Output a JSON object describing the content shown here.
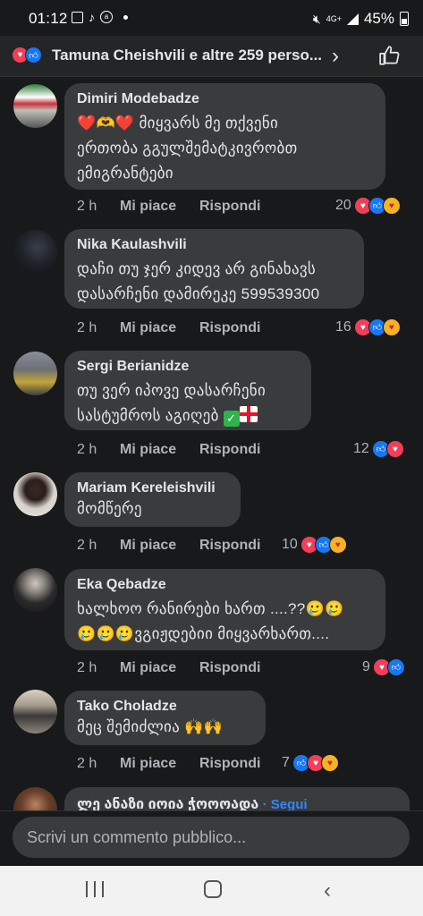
{
  "status_bar": {
    "time": "01:12",
    "network": "4G+",
    "battery": "45%"
  },
  "header": {
    "reaction_summary": "Tamuna Cheishvili e altre 259 perso..."
  },
  "comments": [
    {
      "author": "Dimiri Modebadze",
      "emoji_prefix": "❤️🫶❤️",
      "text": "მიყვარს მე თქვენი\nერთობა გგულშემატკივრობთ\nემიგრანტები",
      "time": "2 h",
      "reaction_count": "20",
      "reactions": [
        "love",
        "like",
        "care"
      ]
    },
    {
      "author": "Nika Kaulashvili",
      "text": "დაჩი თუ ჯერ კიდევ არ გინახავს\nდასარჩენი დამირეკე 599539300",
      "time": "2 h",
      "reaction_count": "16",
      "reactions": [
        "love",
        "like",
        "care"
      ]
    },
    {
      "author": "Sergi Berianidze",
      "text": "თუ ვერ იპოვე დასარჩენი\nსასტუმროს აგიღებ",
      "time": "2 h",
      "reaction_count": "12",
      "reactions": [
        "like",
        "love"
      ]
    },
    {
      "author": "Mariam Kereleishvili",
      "text": "მომწერე",
      "time": "2 h",
      "reaction_count": "10",
      "reactions": [
        "love",
        "like",
        "care"
      ]
    },
    {
      "author": "Eka Qebadze",
      "text": "ხალხოო რანირები ხართ ....??🥲🥲\n🥲🥲🥲ვგიჟდებიი მიყვარხართ....",
      "time": "2 h",
      "reaction_count": "9",
      "reactions": [
        "love",
        "like"
      ]
    },
    {
      "author": "Tako Choladze",
      "text": "მეც შემიძლია 🙌🙌",
      "time": "2 h",
      "reaction_count": "7",
      "reactions": [
        "like",
        "love",
        "care"
      ]
    },
    {
      "author": "ლე ანაზი იოია ჭოოოადა",
      "follow": "· Segui"
    }
  ],
  "actions": {
    "like_label": "Mi piace",
    "reply_label": "Rispondi"
  },
  "input": {
    "placeholder": "Scrivi un commento pubblico..."
  },
  "colors": {
    "background": "#18191a",
    "bubble": "#3a3b3c",
    "like_blue": "#1877f2",
    "love_red": "#f33e58",
    "care_yellow": "#f7b125"
  }
}
